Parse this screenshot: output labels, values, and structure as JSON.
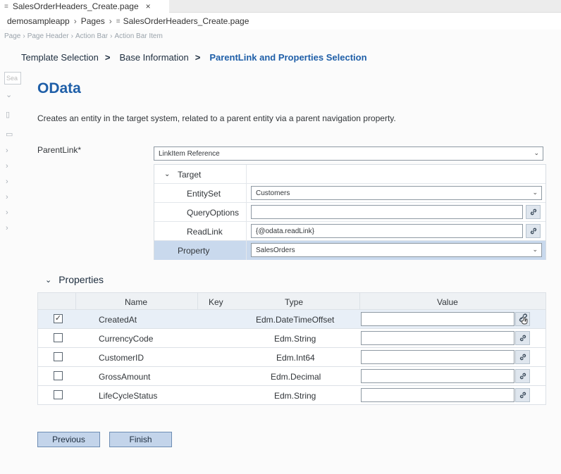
{
  "editor": {
    "tab_title": "SalesOrderHeaders_Create.page",
    "tab_close": "×",
    "path": [
      "demosampleapp",
      "Pages",
      "SalesOrderHeaders_Create.page"
    ],
    "breadcrumb": [
      "Page",
      "Page Header",
      "Action Bar",
      "Action Bar Item"
    ]
  },
  "side": {
    "search_placeholder": "Sea"
  },
  "wizard": {
    "steps": [
      "Template Selection",
      "Base Information",
      "ParentLink and Properties Selection"
    ],
    "active_step": 2,
    "step_arrow": ">"
  },
  "page": {
    "title": "OData",
    "description": "Creates an entity in the target system, related to a parent entity via a parent navigation property."
  },
  "parentlink": {
    "label": "ParentLink*",
    "value": "LinkItem Reference",
    "target_label": "Target",
    "entityset_label": "EntitySet",
    "entityset_value": "Customers",
    "queryoptions_label": "QueryOptions",
    "queryoptions_value": "",
    "readlink_label": "ReadLink",
    "readlink_value": "{@odata.readLink}",
    "property_label": "Property",
    "property_value": "SalesOrders"
  },
  "properties": {
    "header": "Properties",
    "columns": [
      "Name",
      "Key",
      "Type",
      "Value"
    ],
    "rows": [
      {
        "name": "CreatedAt",
        "key": "",
        "type": "Edm.DateTimeOffset",
        "value": "",
        "checked": true,
        "checkmark": "✓"
      },
      {
        "name": "CurrencyCode",
        "key": "",
        "type": "Edm.String",
        "value": "",
        "checked": false,
        "checkmark": ""
      },
      {
        "name": "CustomerID",
        "key": "",
        "type": "Edm.Int64",
        "value": "",
        "checked": false,
        "checkmark": ""
      },
      {
        "name": "GrossAmount",
        "key": "",
        "type": "Edm.Decimal",
        "value": "",
        "checked": false,
        "checkmark": ""
      },
      {
        "name": "LifeCycleStatus",
        "key": "",
        "type": "Edm.String",
        "value": "",
        "checked": false,
        "checkmark": ""
      }
    ]
  },
  "buttons": {
    "previous": "Previous",
    "finish": "Finish"
  },
  "colors": {
    "accent": "#1f5fa8",
    "selected_row": "#c9d9ed",
    "button_bg": "#c3d4ea",
    "link_button_bg": "#dfe6ee"
  },
  "icons": [
    "file-icon",
    "close-icon",
    "chevron-right-icon",
    "chevron-down-icon",
    "link-icon",
    "check-icon",
    "cursor-hand-icon"
  ]
}
